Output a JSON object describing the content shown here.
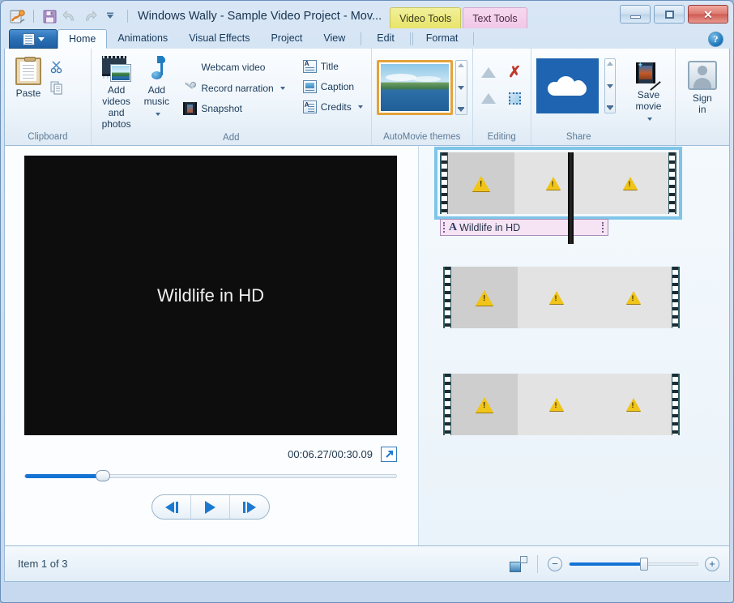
{
  "window": {
    "title": "Windows Wally - Sample Video Project - Mov...",
    "app_icon": "movie-maker-icon",
    "quick_access": [
      {
        "name": "save-icon",
        "label": "Save"
      },
      {
        "name": "undo-icon",
        "label": "Undo"
      },
      {
        "name": "redo-icon",
        "label": "Redo"
      },
      {
        "name": "customize-qat-icon",
        "label": "Customize Quick Access Toolbar"
      }
    ],
    "controls": {
      "minimize": "Minimize",
      "maximize": "Maximize",
      "close": "Close"
    }
  },
  "contextual_tabs": [
    {
      "label": "Video Tools",
      "color": "#e8e46a"
    },
    {
      "label": "Text Tools",
      "color": "#f0c7e8"
    }
  ],
  "ribbon": {
    "file_menu_label": "File",
    "tabs": [
      {
        "label": "Home",
        "active": true
      },
      {
        "label": "Animations",
        "active": false
      },
      {
        "label": "Visual Effects",
        "active": false
      },
      {
        "label": "Project",
        "active": false
      },
      {
        "label": "View",
        "active": false
      },
      {
        "label": "Edit",
        "active": false
      },
      {
        "label": "Format",
        "active": false
      }
    ],
    "help_label": "?",
    "groups": [
      {
        "name": "clipboard",
        "label": "Clipboard",
        "big_buttons": [
          {
            "label": "Paste",
            "icon": "paste-icon"
          }
        ],
        "small_buttons": [
          {
            "label": "Cut",
            "icon": "scissors-icon"
          },
          {
            "label": "Copy",
            "icon": "copy-icon"
          }
        ]
      },
      {
        "name": "add",
        "label": "Add",
        "big_buttons": [
          {
            "label": "Add videos\nand photos",
            "line1": "Add videos",
            "line2": "and photos",
            "icon": "add-videos-and-photos-icon"
          },
          {
            "label": "Add music",
            "line1": "Add",
            "line2": "music",
            "icon": "add-music-icon",
            "dropdown": true
          }
        ],
        "small_buttons": [
          {
            "label": "Webcam video",
            "icon": "webcam-icon",
            "dropdown": false
          },
          {
            "label": "Record narration",
            "icon": "microphone-icon",
            "dropdown": true
          },
          {
            "label": "Snapshot",
            "icon": "snapshot-icon",
            "dropdown": false
          },
          {
            "label": "Title",
            "icon": "title-icon",
            "dropdown": false
          },
          {
            "label": "Caption",
            "icon": "caption-icon",
            "dropdown": false
          },
          {
            "label": "Credits",
            "icon": "credits-icon",
            "dropdown": true
          }
        ]
      },
      {
        "name": "automovie-themes",
        "label": "AutoMovie themes",
        "gallery_item": "landscape-theme-thumbnail"
      },
      {
        "name": "editing",
        "label": "Editing",
        "tools": [
          {
            "name": "fade-in-icon",
            "label": "Fade in"
          },
          {
            "name": "remove-icon",
            "label": "Remove"
          },
          {
            "name": "fade-out-icon",
            "label": "Fade out"
          },
          {
            "name": "select-all-icon",
            "label": "Select all"
          }
        ]
      },
      {
        "name": "share",
        "label": "Share",
        "onedrive_label": "OneDrive",
        "save_movie": {
          "line1": "Save",
          "line2": "movie",
          "icon": "save-movie-icon",
          "dropdown": true
        },
        "sign_in": {
          "line1": "Sign",
          "line2": "in",
          "icon": "user-icon"
        }
      }
    ]
  },
  "preview": {
    "video_caption": "Wildlife in HD",
    "time_display": "00:06.27/00:30.09",
    "fullscreen_icon": "fullscreen-icon",
    "seek_percent": 21,
    "transport": [
      {
        "name": "previous-frame-button",
        "label": "Previous frame"
      },
      {
        "name": "play-button",
        "label": "Play"
      },
      {
        "name": "next-frame-button",
        "label": "Next frame"
      }
    ]
  },
  "storyboard": {
    "clips": [
      {
        "name": "clip-1",
        "selected": true,
        "frames": [
          "warning-icon",
          "warning-icon",
          "warning-icon"
        ],
        "title_overlay": {
          "text": "Wildlife in HD",
          "icon": "title-text-icon"
        }
      },
      {
        "name": "clip-2",
        "selected": false,
        "frames": [
          "warning-icon",
          "warning-icon",
          "warning-icon"
        ],
        "title_overlay": null
      },
      {
        "name": "clip-3",
        "selected": false,
        "frames": [
          "warning-icon",
          "warning-icon",
          "warning-icon"
        ],
        "title_overlay": null
      }
    ],
    "playhead_label": "playhead"
  },
  "statusbar": {
    "item_status": "Item 1 of 3",
    "thumbnail_view_icon": "storyboard-view-icon",
    "zoom_out_label": "−",
    "zoom_in_label": "+",
    "zoom_percent": 58
  }
}
